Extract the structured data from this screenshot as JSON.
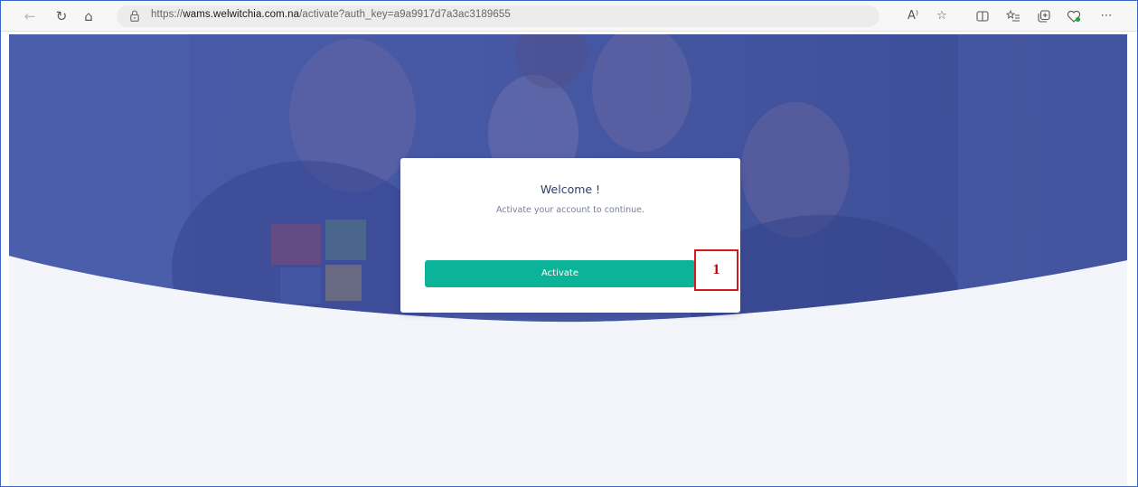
{
  "browser": {
    "url_prefix": "https://",
    "url_domain": "wams.welwitchia.com.na",
    "url_path": "/activate?auth_key=a9a9917d7a3ac3189655",
    "read_aloud_label": "A⁾"
  },
  "card": {
    "title": "Welcome !",
    "subtitle": "Activate your account to continue.",
    "activate_label": "Activate"
  },
  "annotation": {
    "step_number": "1"
  },
  "colors": {
    "accent": "#0bb399",
    "hero_overlay": "#3d4e9c",
    "page_bg": "#f4f5fa",
    "callout": "#d41a1a"
  }
}
